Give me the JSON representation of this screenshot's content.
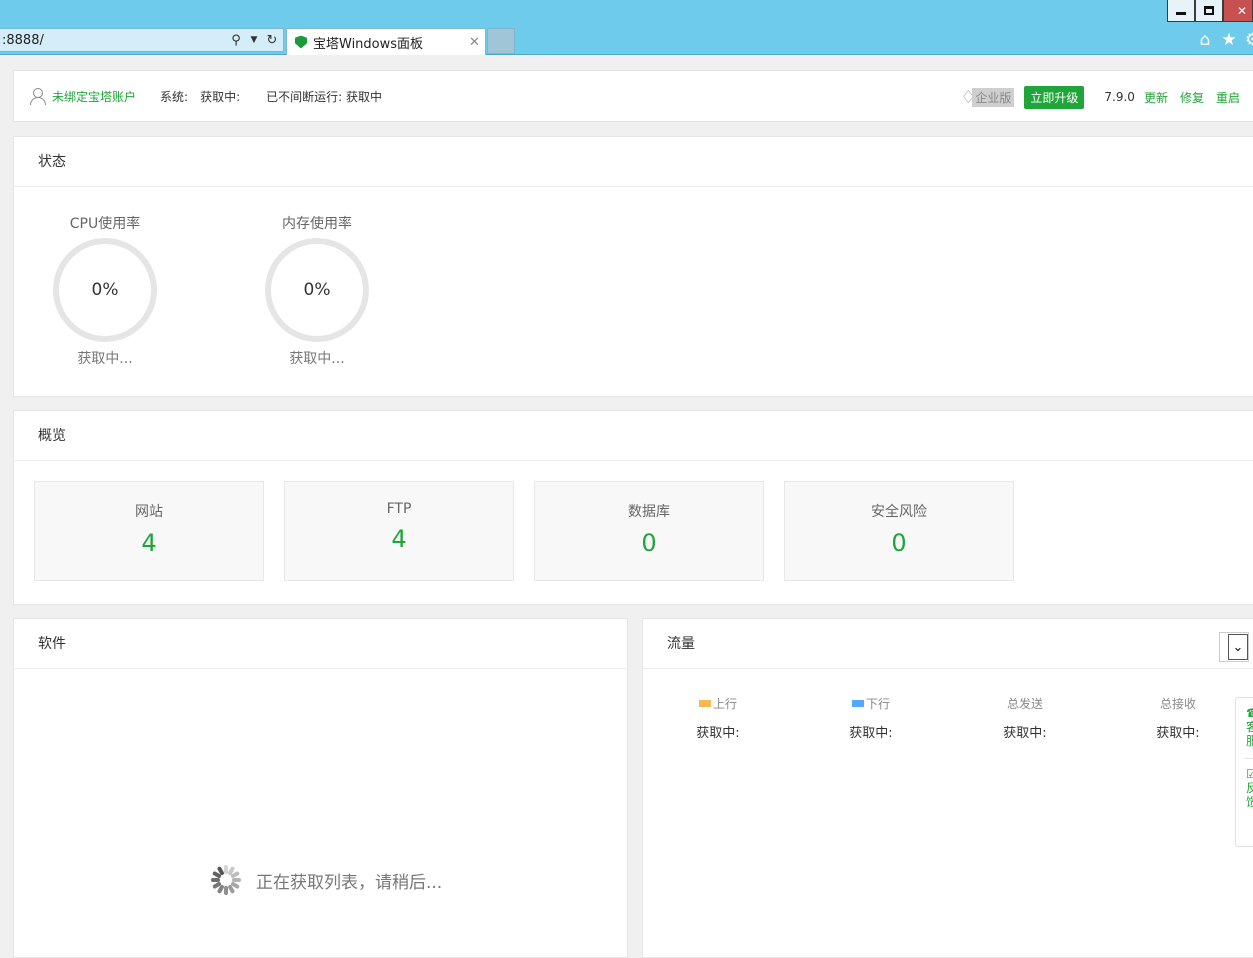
{
  "browser": {
    "url": ":8888/",
    "tab_title": "宝塔Windows面板",
    "tab_close": "✕",
    "min_label": "",
    "max_label": "",
    "close_label": "✕"
  },
  "topbar": {
    "account": "未绑定宝塔账户",
    "system_label": "系统:",
    "system_value": "获取中:",
    "uptime": "已不间断运行: 获取中",
    "enterprise": "企业版",
    "upgrade": "立即升级",
    "version": "7.9.0",
    "update": "更新",
    "repair": "修复",
    "restart": "重启"
  },
  "state": {
    "title": "状态",
    "gauges": [
      {
        "label": "CPU使用率",
        "value": "0%",
        "status": "获取中..."
      },
      {
        "label": "内存使用率",
        "value": "0%",
        "status": "获取中..."
      }
    ]
  },
  "overview": {
    "title": "概览",
    "items": [
      {
        "label": "网站",
        "value": "4"
      },
      {
        "label": "FTP",
        "value": "4"
      },
      {
        "label": "数据库",
        "value": "0"
      },
      {
        "label": "安全风险",
        "value": "0"
      }
    ]
  },
  "software": {
    "title": "软件",
    "loading": "正在获取列表，请稍后..."
  },
  "traffic": {
    "title": "流量",
    "columns": [
      {
        "label": "上行",
        "value": "获取中:",
        "color": "#f7b851"
      },
      {
        "label": "下行",
        "value": "获取中:",
        "color": "#52a9ff"
      },
      {
        "label": "总发送",
        "value": "获取中:"
      },
      {
        "label": "总接收",
        "value": "获取中:"
      }
    ]
  },
  "floater": {
    "service": "客服",
    "feedback": "反馈"
  },
  "colors": {
    "accent": "#20a53a",
    "chrome": "#6ecbec"
  }
}
